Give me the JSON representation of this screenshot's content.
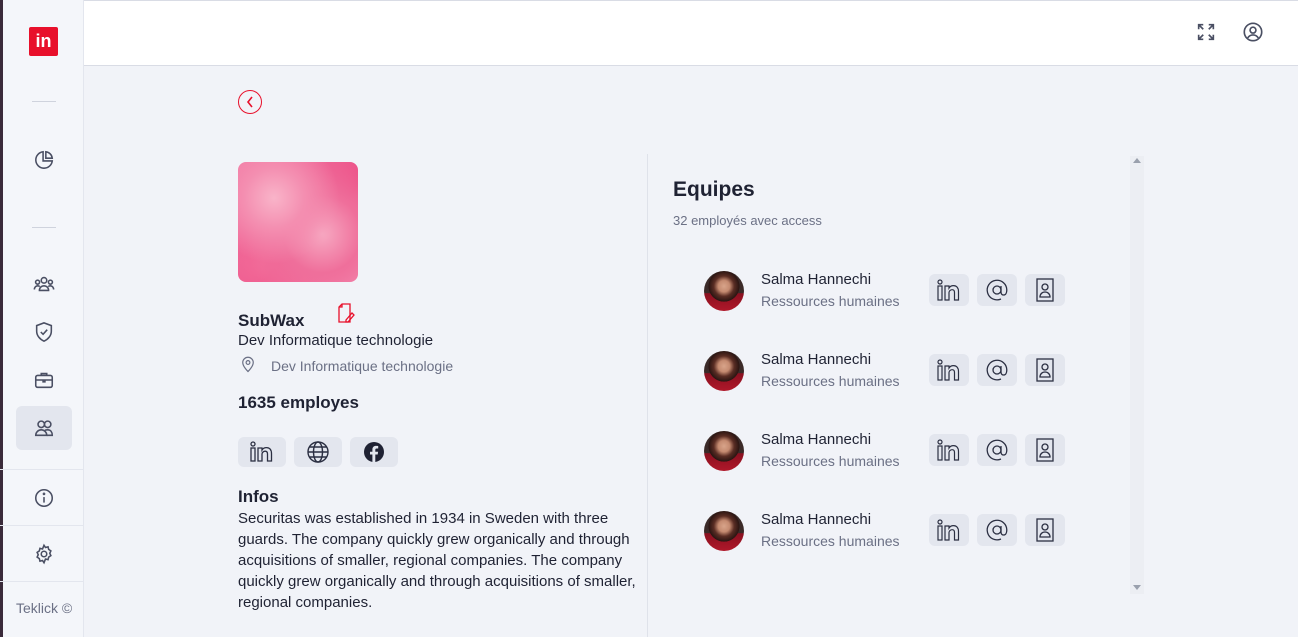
{
  "sidebar": {
    "logo_text": "in",
    "items": [
      {
        "name": "dashboard-icon"
      },
      {
        "name": "users-group-icon"
      },
      {
        "name": "shield-check-icon"
      },
      {
        "name": "briefcase-icon"
      },
      {
        "name": "contacts-icon",
        "active": true
      },
      {
        "name": "info-icon"
      },
      {
        "name": "gear-icon"
      }
    ],
    "copyright": "Teklick ©"
  },
  "topbar": {
    "icons": [
      "fullscreen-icon",
      "user-circle-icon"
    ]
  },
  "company": {
    "name": "SubWax",
    "sector": "Dev Informatique technologie",
    "location": "Dev Informatique technologie",
    "employees": "1635 employes",
    "socials": [
      "linkedin-icon",
      "globe-icon",
      "facebook-icon"
    ],
    "infos_title": "Infos",
    "infos_text": "Securitas was established in 1934 in Sweden with three guards. The company quickly grew organically and through acquisitions of smaller, regional companies. The company quickly grew organically and through acquisitions of smaller, regional companies."
  },
  "team": {
    "title": "Equipes",
    "subtitle": "32 employés avec access",
    "members": [
      {
        "name": "Salma Hannechi",
        "role": "Ressources humaines"
      },
      {
        "name": "Salma Hannechi",
        "role": "Ressources humaines"
      },
      {
        "name": "Salma Hannechi",
        "role": "Ressources humaines"
      },
      {
        "name": "Salma Hannechi",
        "role": "Ressources humaines"
      }
    ]
  },
  "colors": {
    "accent": "#e8102b",
    "background": "#f1f3f8",
    "muted_text": "#6b7085"
  }
}
